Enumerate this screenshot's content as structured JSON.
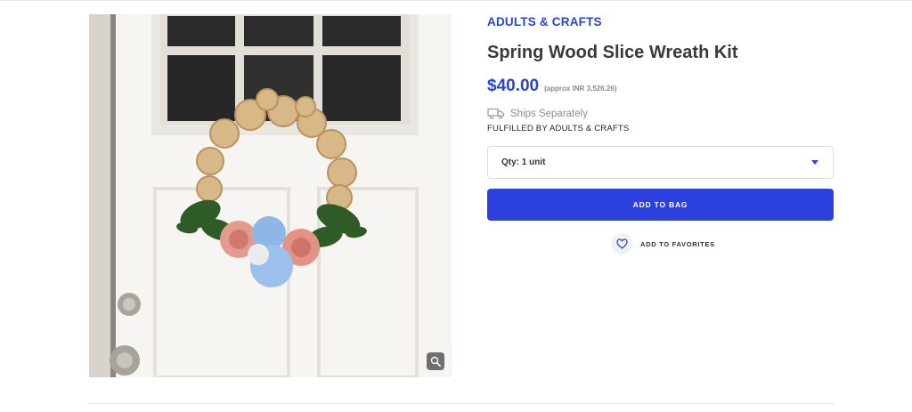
{
  "product": {
    "brand": "ADULTS & CRAFTS",
    "title": "Spring Wood Slice Wreath Kit",
    "price": "$40.00",
    "approx_price": "(approx INR 3,526.26)",
    "shipping": "Ships Separately",
    "fulfilled_by": "FULFILLED BY ADULTS & CRAFTS",
    "quantity_label": "Qty: 1 unit",
    "add_to_bag": "ADD TO BAG",
    "add_to_favorites": "ADD TO FAVORITES"
  },
  "icons": {
    "shipping": "truck-icon",
    "quantity_dropdown": "caret-down-icon",
    "favorites": "heart-icon",
    "zoom": "zoom-icon"
  },
  "colors": {
    "accent": "#2b43d6",
    "button": "#2b40df",
    "muted_text": "#8d8d8d"
  }
}
